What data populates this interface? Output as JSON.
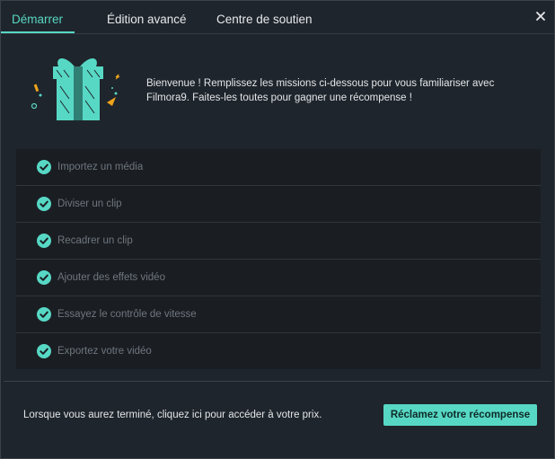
{
  "tabs": [
    {
      "label": "Démarrer",
      "active": true
    },
    {
      "label": "Édition avancé",
      "active": false
    },
    {
      "label": "Centre de soutien",
      "active": false
    }
  ],
  "welcome_text": "Bienvenue ! Remplissez les missions ci-dessous pour vous familiariser avec Filmora9. Faites-les toutes pour gagner une récompense !",
  "missions": [
    {
      "label": "Importez un média",
      "completed": true
    },
    {
      "label": "Diviser un clip",
      "completed": true
    },
    {
      "label": "Recadrer un clip",
      "completed": true
    },
    {
      "label": "Ajouter des effets vidéo",
      "completed": true
    },
    {
      "label": "Essayez le contrôle de vitesse",
      "completed": true
    },
    {
      "label": "Exportez votre vidéo",
      "completed": true
    }
  ],
  "footer": {
    "text": "Lorsque vous aurez terminé, cliquez ici pour accéder à votre prix.",
    "claim_button": "Réclamez votre récompense"
  },
  "icons": {
    "close": "close-icon",
    "check": "check-circle-icon",
    "gift": "gift-icon"
  },
  "colors": {
    "accent": "#57d8c5",
    "background": "#1f252c",
    "row_background": "#1a1e23",
    "muted_text": "#6f767e",
    "confetti": "#f0a41c"
  }
}
